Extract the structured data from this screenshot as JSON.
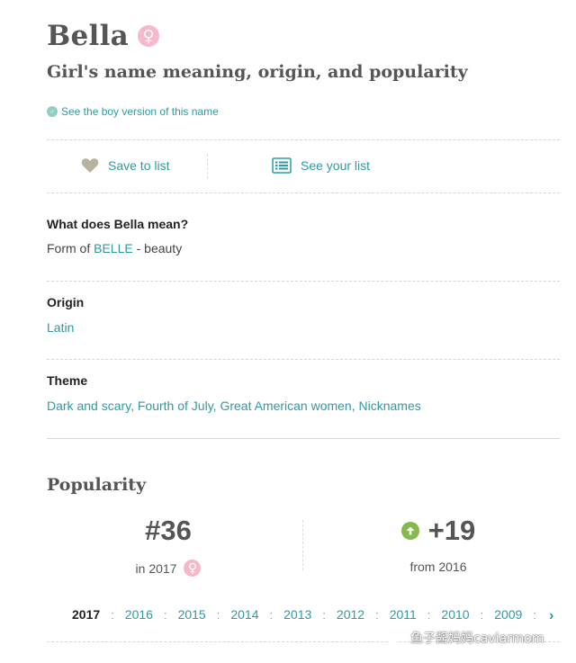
{
  "header": {
    "name": "Bella",
    "gender_symbol": "♀",
    "subtitle": "Girl's name meaning, origin, and popularity",
    "boy_link": "See the boy version of this name"
  },
  "actions": {
    "save_label": "Save to list",
    "list_label": "See your list"
  },
  "meaning": {
    "title": "What does Bella mean?",
    "prefix": "Form of ",
    "link": "BELLE",
    "suffix": " - beauty"
  },
  "origin": {
    "title": "Origin",
    "value": "Latin"
  },
  "theme": {
    "title": "Theme",
    "value": "Dark and scary, Fourth of July, Great American women, Nicknames"
  },
  "popularity": {
    "title": "Popularity",
    "rank": "#36",
    "rank_label": "in 2017",
    "change": "+19",
    "change_label": "from 2016",
    "years": [
      "2017",
      "2016",
      "2015",
      "2014",
      "2013",
      "2012",
      "2011",
      "2010",
      "2009"
    ],
    "separator": ":"
  },
  "watermark": {
    "text": "鱼子酱妈妈caviarmom"
  },
  "colors": {
    "accent": "#2e9aa3",
    "girl_pink": "#f6b8cb",
    "up_green": "#85b94c"
  },
  "icons": {
    "gender": "female-icon",
    "save": "heart-icon",
    "list": "list-icon",
    "up": "arrow-up-icon",
    "next": "chevron-right-icon"
  }
}
